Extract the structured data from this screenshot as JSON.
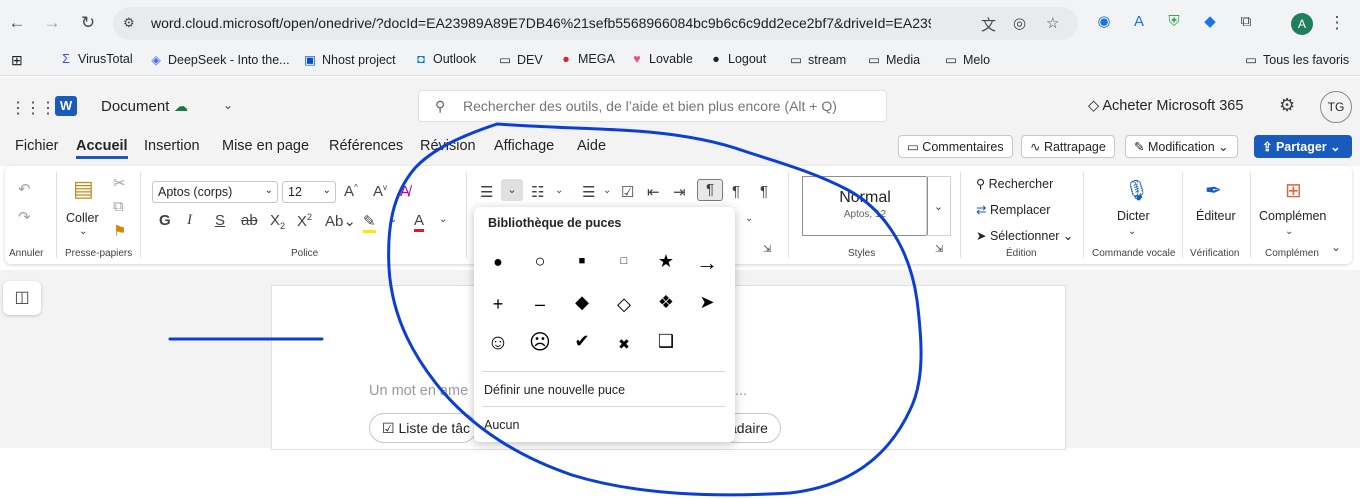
{
  "browser": {
    "url": "word.cloud.microsoft/open/onedrive/?docId=EA23989A89E7DB46%21sefb5568966084bc9b6c6c9dd2ece2bf7&driveId=EA23989A...",
    "profile_initial": "A",
    "bookmarks": [
      {
        "label": "VirusTotal",
        "icon": "virustotal-icon"
      },
      {
        "label": "DeepSeek - Into the...",
        "icon": "deepseek-icon"
      },
      {
        "label": "Nhost project",
        "icon": "nhost-icon"
      },
      {
        "label": "Outlook",
        "icon": "outlook-icon"
      },
      {
        "label": "DEV",
        "icon": "folder-icon"
      },
      {
        "label": "MEGA",
        "icon": "mega-icon"
      },
      {
        "label": "Lovable",
        "icon": "lovable-icon"
      },
      {
        "label": "Logout",
        "icon": "github-icon"
      },
      {
        "label": "stream",
        "icon": "folder-icon"
      },
      {
        "label": "Media",
        "icon": "folder-icon"
      },
      {
        "label": "Melo",
        "icon": "folder-icon"
      }
    ],
    "all_bookmarks_label": "Tous les favoris"
  },
  "word": {
    "doc_title": "Document",
    "search_placeholder": "Rechercher des outils, de l’aide et bien plus encore (Alt + Q)",
    "buy_label": "Acheter Microsoft 365",
    "user_initials": "TG",
    "tabs": [
      "Fichier",
      "Accueil",
      "Insertion",
      "Mise en page",
      "Références",
      "Révision",
      "Affichage",
      "Aide"
    ],
    "active_tab": "Accueil",
    "comments_label": "Commentaires",
    "catchup_label": "Rattrapage",
    "editing_label": "Modification",
    "share_label": "Partager"
  },
  "ribbon": {
    "undo_group": "Annuler",
    "paste_label": "Coller",
    "clipboard_group": "Presse-papiers",
    "font_name": "Aptos (corps)",
    "font_size": "12",
    "font_group": "Police",
    "style_name": "Normal",
    "style_sub": "Aptos, 12",
    "styles_group": "Styles",
    "find_label": "Rechercher",
    "replace_label": "Remplacer",
    "select_label": "Sélectionner",
    "editing_group": "Édition",
    "dictate_label": "Dicter",
    "voice_group": "Commande vocale",
    "editor_label": "Éditeur",
    "verify_group": "Vérification",
    "addins_label": "Complémen",
    "addins_group": "Complémen"
  },
  "document": {
    "prompt_text": "Un mot en ame",
    "ellipsis": "...",
    "task_pill": "Liste de tâc",
    "other_pill": "adaire"
  },
  "bullet_library": {
    "title": "Bibliothèque de puces",
    "bullets": [
      "●",
      "○",
      "■",
      "□",
      "★",
      "→",
      "+",
      "–",
      "◆",
      "◇",
      "❖",
      "➤",
      "☺",
      "☹",
      "✔",
      "✖",
      "❑"
    ],
    "define_new": "Définir une nouvelle puce",
    "none": "Aucun"
  },
  "colors": {
    "accent": "#185abd",
    "ink": "#0a3fd6",
    "font_color_bar": "#e01b1b",
    "highlight_bar": "#ffe600"
  }
}
